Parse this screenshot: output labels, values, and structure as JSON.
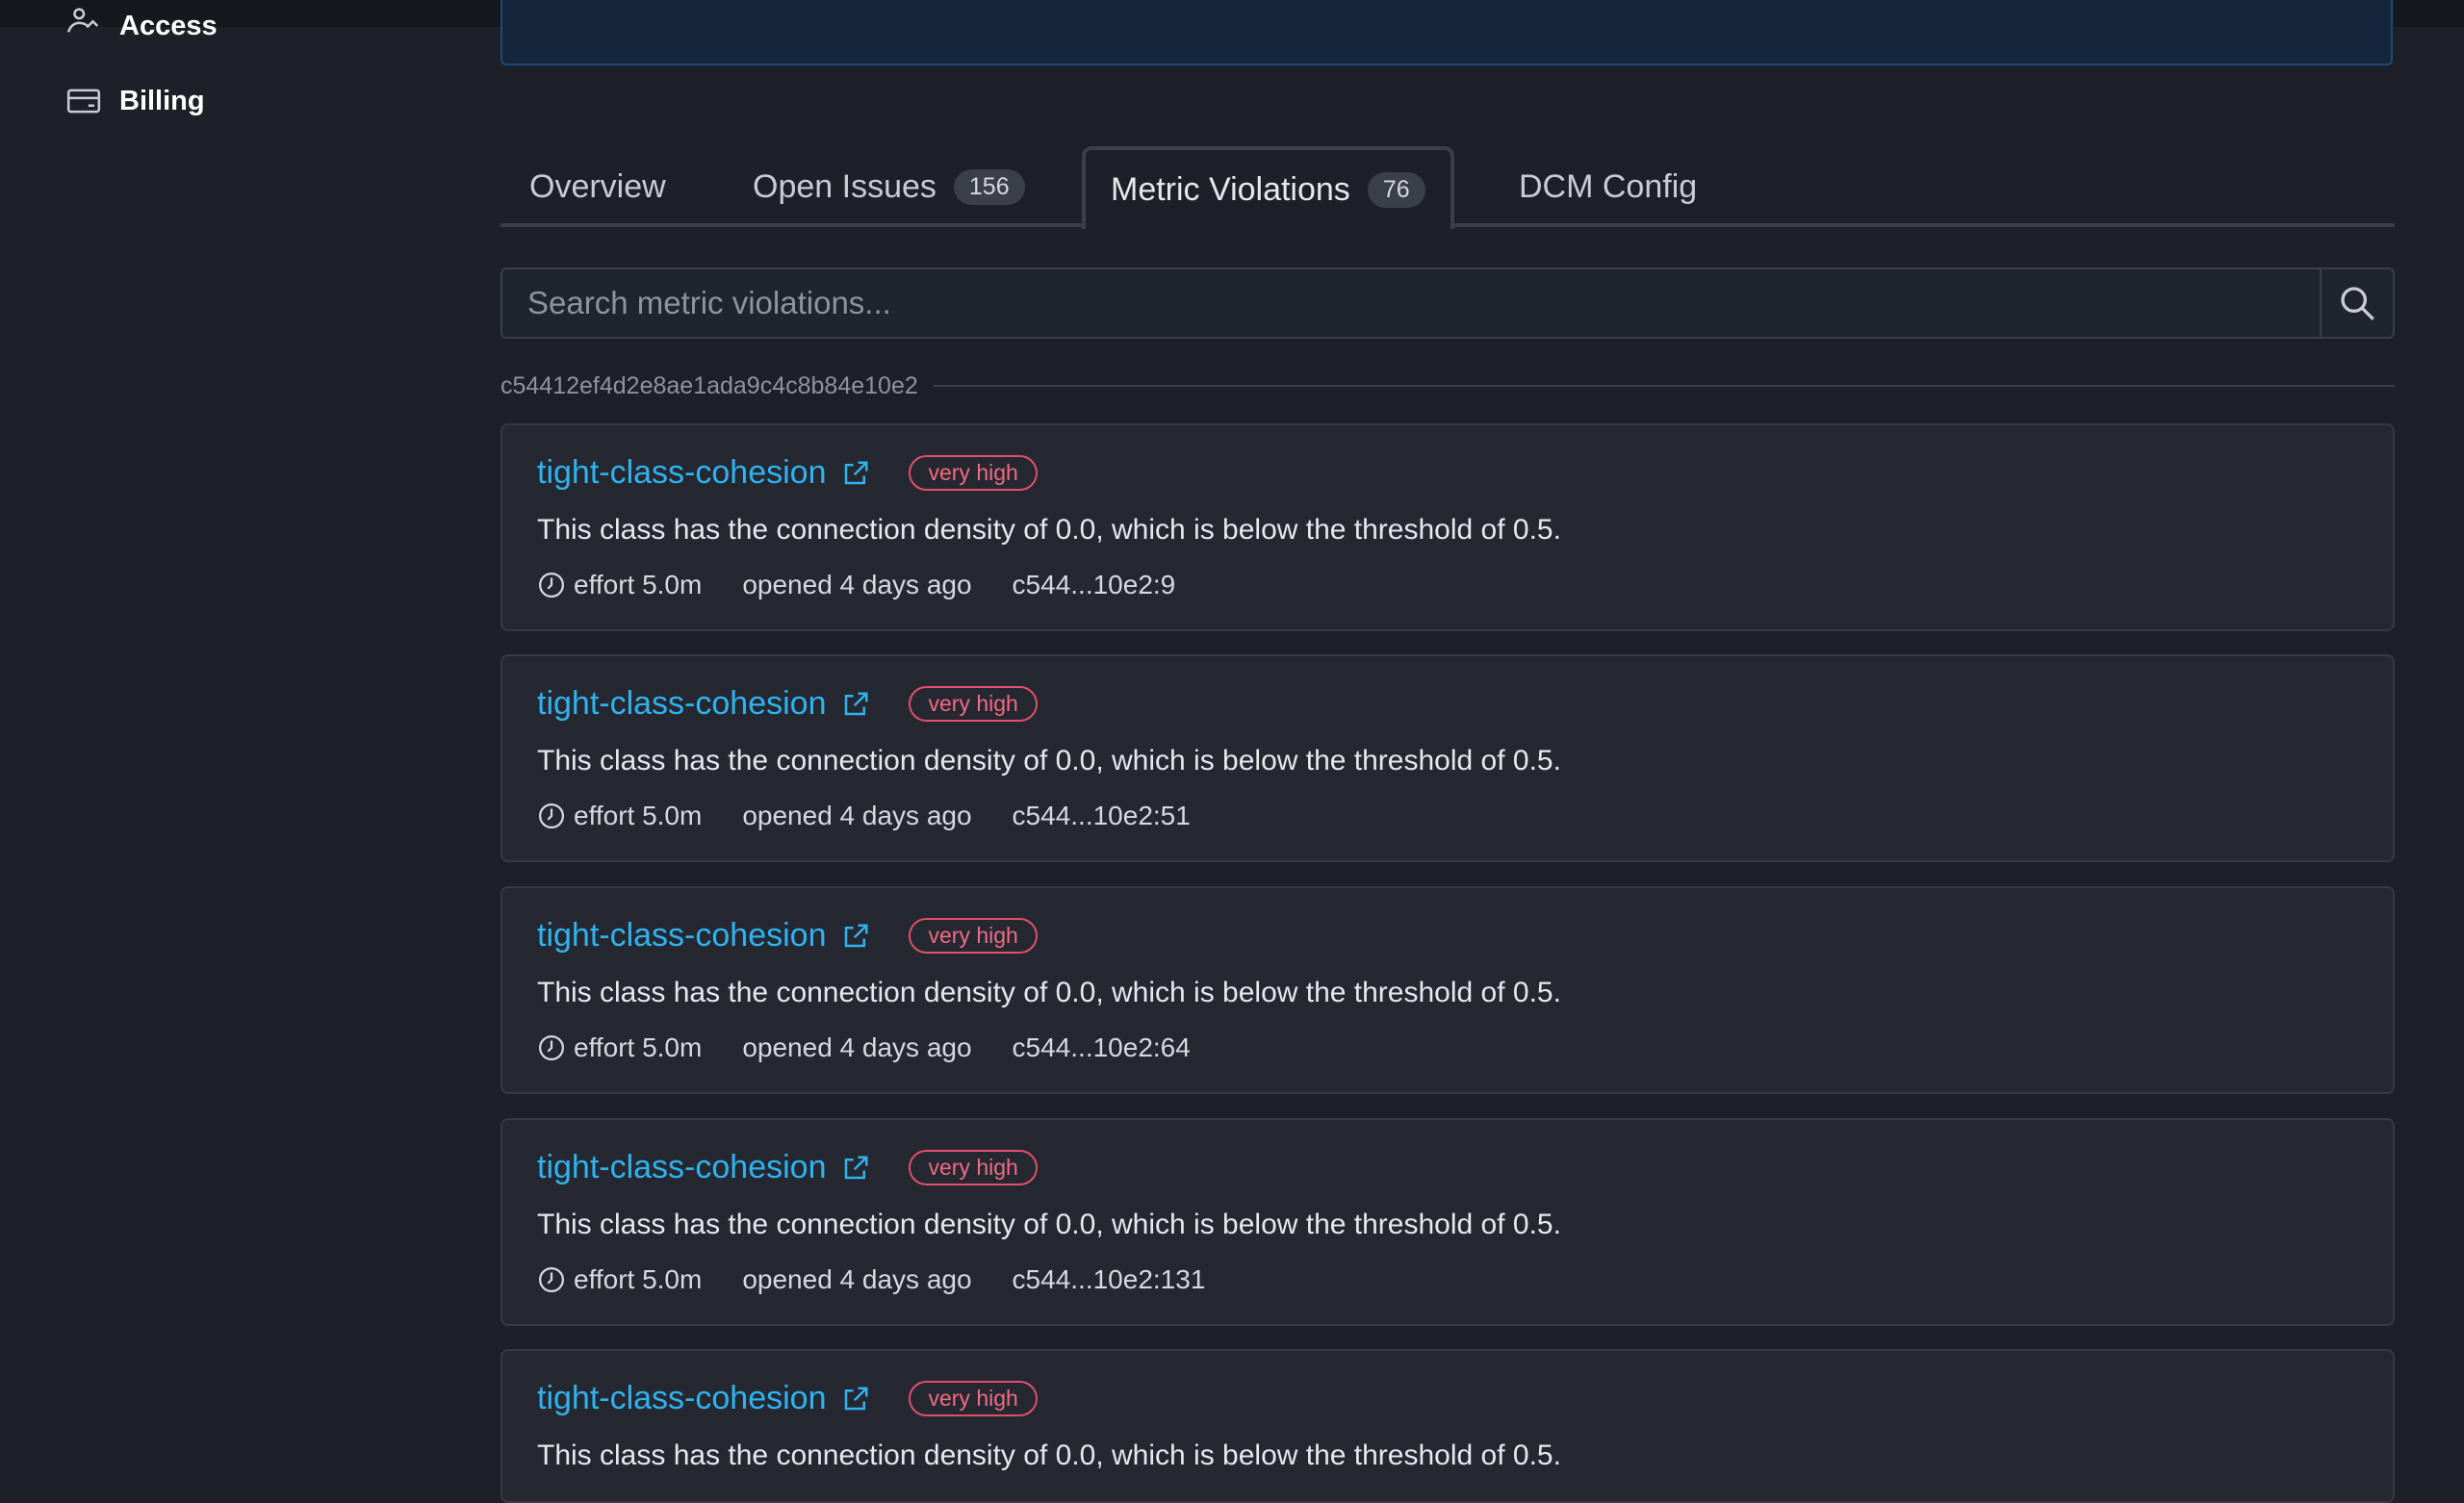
{
  "sidebar": {
    "items": [
      {
        "label": "Access",
        "icon": "access-icon"
      },
      {
        "label": "Billing",
        "icon": "credit-card-icon"
      }
    ]
  },
  "tabs": [
    {
      "label": "Overview",
      "count": null,
      "active": false
    },
    {
      "label": "Open Issues",
      "count": "156",
      "active": false
    },
    {
      "label": "Metric Violations",
      "count": "76",
      "active": true
    },
    {
      "label": "DCM Config",
      "count": null,
      "active": false
    }
  ],
  "search": {
    "placeholder": "Search metric violations...",
    "value": ""
  },
  "commit": {
    "hash": "c54412ef4d2e8ae1ada9c4c8b84e10e2"
  },
  "violations": [
    {
      "rule": "tight-class-cohesion",
      "severity": "very high",
      "message": "This class has the connection density of 0.0, which is below the threshold of 0.5.",
      "effort": "effort 5.0m",
      "opened": "opened 4 days ago",
      "location": "c544...10e2:9"
    },
    {
      "rule": "tight-class-cohesion",
      "severity": "very high",
      "message": "This class has the connection density of 0.0, which is below the threshold of 0.5.",
      "effort": "effort 5.0m",
      "opened": "opened 4 days ago",
      "location": "c544...10e2:51"
    },
    {
      "rule": "tight-class-cohesion",
      "severity": "very high",
      "message": "This class has the connection density of 0.0, which is below the threshold of 0.5.",
      "effort": "effort 5.0m",
      "opened": "opened 4 days ago",
      "location": "c544...10e2:64"
    },
    {
      "rule": "tight-class-cohesion",
      "severity": "very high",
      "message": "This class has the connection density of 0.0, which is below the threshold of 0.5.",
      "effort": "effort 5.0m",
      "opened": "opened 4 days ago",
      "location": "c544...10e2:131"
    },
    {
      "rule": "tight-class-cohesion",
      "severity": "very high",
      "message": "This class has the connection density of 0.0, which is below the threshold of 0.5.",
      "effort": "",
      "opened": "",
      "location": ""
    }
  ],
  "colors": {
    "background": "#1d2027",
    "card": "#252831",
    "link": "#2fb3ef",
    "severity": "#e0506a",
    "border": "#3b3f48"
  }
}
